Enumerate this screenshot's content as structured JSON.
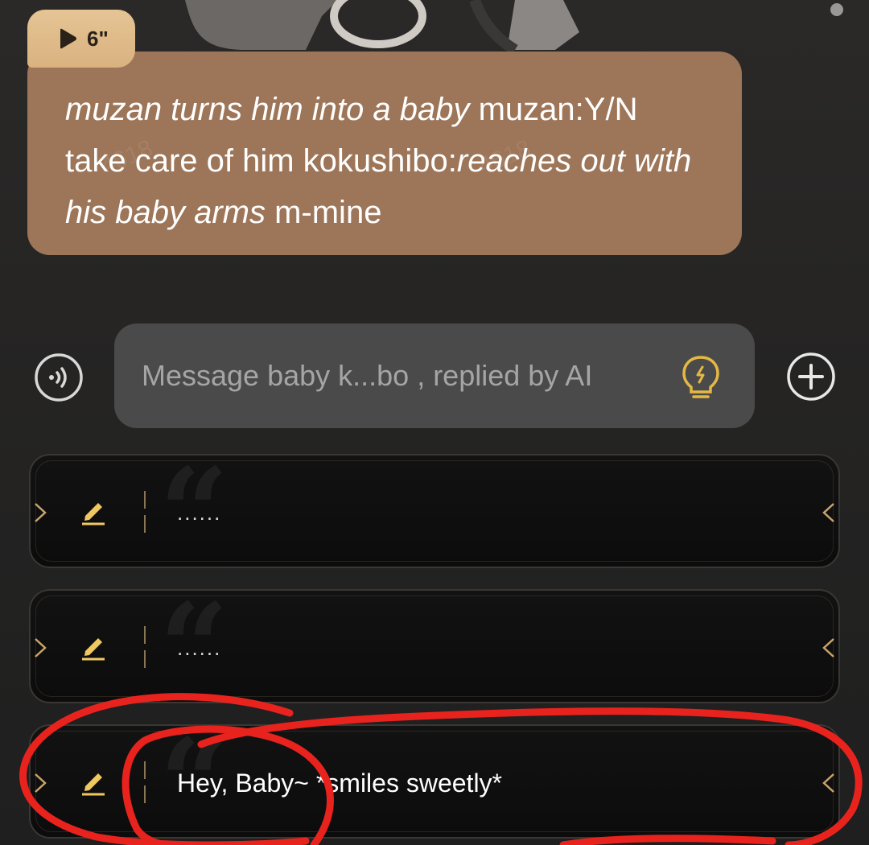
{
  "audio": {
    "duration": "6\""
  },
  "message": {
    "segments": [
      {
        "text": "muzan turns him into a baby",
        "italic": true
      },
      {
        "text": " muzan:Y/N take care of him kokushibo:",
        "italic": false
      },
      {
        "text": "reaches out with his baby arms",
        "italic": true
      },
      {
        "text": " m-mine",
        "italic": false
      }
    ]
  },
  "input": {
    "placeholder": "Message baby k...bo , replied by AI"
  },
  "suggestions": [
    {
      "text": "......"
    },
    {
      "text": "......"
    },
    {
      "text": "Hey, Baby~ *smiles sweetly*"
    }
  ],
  "colors": {
    "bubble": "#9d7558",
    "pill": "#e0bb89",
    "accent_gold": "#f0c862",
    "annotation_red": "#e8231e"
  },
  "icons": {
    "voice": "voice-wave-icon",
    "hint": "lightbulb-icon",
    "add": "plus-circle-icon",
    "edit": "pencil-icon",
    "play": "play-icon"
  }
}
